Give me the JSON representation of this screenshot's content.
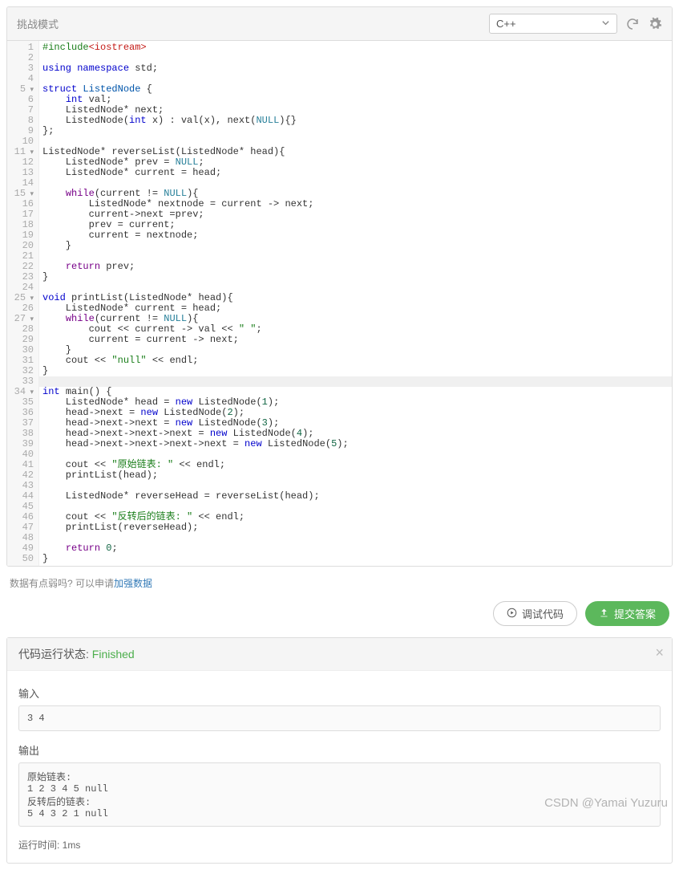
{
  "header": {
    "mode_label": "挑战模式",
    "language": "C++"
  },
  "code": {
    "lines": [
      {
        "n": 1,
        "fold": false,
        "html": "<span class='tok-dir'>#include</span><span class='tok-inc'>&lt;iostream&gt;</span>"
      },
      {
        "n": 2,
        "fold": false,
        "html": ""
      },
      {
        "n": 3,
        "fold": false,
        "html": "<span class='tok-kw'>using</span> <span class='tok-kw'>namespace</span> std;"
      },
      {
        "n": 4,
        "fold": false,
        "html": ""
      },
      {
        "n": 5,
        "fold": true,
        "html": "<span class='tok-kw'>struct</span> <span class='tok-ty'>ListedNode</span> {"
      },
      {
        "n": 6,
        "fold": false,
        "html": "    <span class='tok-kw'>int</span> val;"
      },
      {
        "n": 7,
        "fold": false,
        "html": "    ListedNode* next;"
      },
      {
        "n": 8,
        "fold": false,
        "html": "    ListedNode(<span class='tok-kw'>int</span> x) : val(x), next(<span class='tok-con'>NULL</span>){}"
      },
      {
        "n": 9,
        "fold": false,
        "html": "};"
      },
      {
        "n": 10,
        "fold": false,
        "html": ""
      },
      {
        "n": 11,
        "fold": true,
        "html": "ListedNode* <span class='tok-fn'>reverseList</span>(ListedNode* head){"
      },
      {
        "n": 12,
        "fold": false,
        "html": "    ListedNode* prev = <span class='tok-con'>NULL</span>;"
      },
      {
        "n": 13,
        "fold": false,
        "html": "    ListedNode* current = head;"
      },
      {
        "n": 14,
        "fold": false,
        "html": ""
      },
      {
        "n": 15,
        "fold": true,
        "html": "    <span class='tok-kw2'>while</span>(current != <span class='tok-con'>NULL</span>){"
      },
      {
        "n": 16,
        "fold": false,
        "html": "        ListedNode* nextnode = current -&gt; next;"
      },
      {
        "n": 17,
        "fold": false,
        "html": "        current-&gt;next =prev;"
      },
      {
        "n": 18,
        "fold": false,
        "html": "        prev = current;"
      },
      {
        "n": 19,
        "fold": false,
        "html": "        current = nextnode;"
      },
      {
        "n": 20,
        "fold": false,
        "html": "    }"
      },
      {
        "n": 21,
        "fold": false,
        "html": ""
      },
      {
        "n": 22,
        "fold": false,
        "html": "    <span class='tok-kw2'>return</span> prev;"
      },
      {
        "n": 23,
        "fold": false,
        "html": "}"
      },
      {
        "n": 24,
        "fold": false,
        "html": ""
      },
      {
        "n": 25,
        "fold": true,
        "html": "<span class='tok-kw'>void</span> <span class='tok-fn'>printList</span>(ListedNode* head){"
      },
      {
        "n": 26,
        "fold": false,
        "html": "    ListedNode* current = head;"
      },
      {
        "n": 27,
        "fold": true,
        "html": "    <span class='tok-kw2'>while</span>(current != <span class='tok-con'>NULL</span>){"
      },
      {
        "n": 28,
        "fold": false,
        "html": "        cout &lt;&lt; current -&gt; val &lt;&lt; <span class='tok-str'>\" \"</span>;"
      },
      {
        "n": 29,
        "fold": false,
        "html": "        current = current -&gt; next;"
      },
      {
        "n": 30,
        "fold": false,
        "html": "    }"
      },
      {
        "n": 31,
        "fold": false,
        "html": "    cout &lt;&lt; <span class='tok-str'>\"null\"</span> &lt;&lt; endl;"
      },
      {
        "n": 32,
        "fold": false,
        "html": "}"
      },
      {
        "n": 33,
        "fold": false,
        "html": "",
        "hl": true
      },
      {
        "n": 34,
        "fold": true,
        "html": "<span class='tok-kw'>int</span> <span class='tok-fn'>main</span>() {"
      },
      {
        "n": 35,
        "fold": false,
        "html": "    ListedNode* head = <span class='tok-kw'>new</span> ListedNode(<span class='tok-num'>1</span>);"
      },
      {
        "n": 36,
        "fold": false,
        "html": "    head-&gt;next = <span class='tok-kw'>new</span> ListedNode(<span class='tok-num'>2</span>);"
      },
      {
        "n": 37,
        "fold": false,
        "html": "    head-&gt;next-&gt;next = <span class='tok-kw'>new</span> ListedNode(<span class='tok-num'>3</span>);"
      },
      {
        "n": 38,
        "fold": false,
        "html": "    head-&gt;next-&gt;next-&gt;next = <span class='tok-kw'>new</span> ListedNode(<span class='tok-num'>4</span>);"
      },
      {
        "n": 39,
        "fold": false,
        "html": "    head-&gt;next-&gt;next-&gt;next-&gt;next = <span class='tok-kw'>new</span> ListedNode(<span class='tok-num'>5</span>);"
      },
      {
        "n": 40,
        "fold": false,
        "html": ""
      },
      {
        "n": 41,
        "fold": false,
        "html": "    cout &lt;&lt; <span class='tok-str'>\"原始链表: \"</span> &lt;&lt; endl;"
      },
      {
        "n": 42,
        "fold": false,
        "html": "    printList(head);"
      },
      {
        "n": 43,
        "fold": false,
        "html": ""
      },
      {
        "n": 44,
        "fold": false,
        "html": "    ListedNode* reverseHead = reverseList(head);"
      },
      {
        "n": 45,
        "fold": false,
        "html": ""
      },
      {
        "n": 46,
        "fold": false,
        "html": "    cout &lt;&lt; <span class='tok-str'>\"反转后的链表: \"</span> &lt;&lt; endl;"
      },
      {
        "n": 47,
        "fold": false,
        "html": "    printList(reverseHead);"
      },
      {
        "n": 48,
        "fold": false,
        "html": ""
      },
      {
        "n": 49,
        "fold": false,
        "html": "    <span class='tok-kw2'>return</span> <span class='tok-num'>0</span>;"
      },
      {
        "n": 50,
        "fold": false,
        "html": "}"
      }
    ]
  },
  "footer_hint": {
    "prefix": "数据有点弱吗? 可以申请",
    "link": "加强数据"
  },
  "actions": {
    "debug_label": "调试代码",
    "submit_label": "提交答案"
  },
  "result": {
    "status_label": "代码运行状态:  ",
    "status_value": "Finished",
    "input_label": "输入",
    "input_value": "3 4",
    "output_label": "输出",
    "output_value": "原始链表:\n1 2 3 4 5 null\n反转后的链表:\n5 4 3 2 1 null",
    "runtime_label": "运行时间:  ",
    "runtime_value": "1ms"
  },
  "watermark": "CSDN @Yamai Yuzuru"
}
